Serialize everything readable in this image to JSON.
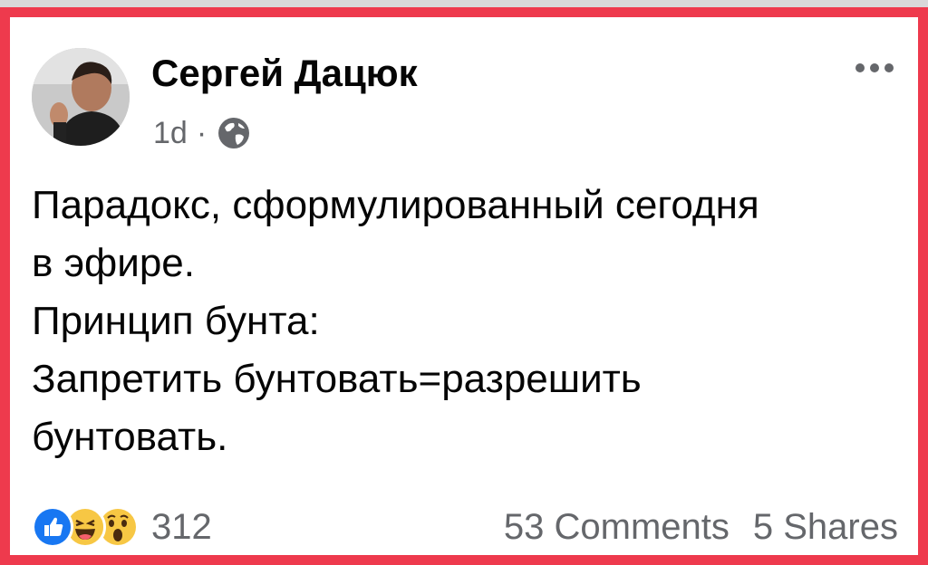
{
  "post": {
    "author": "Сергей Дацюк",
    "time": "1d",
    "separator": "·",
    "audience_icon": "globe-icon",
    "lines": [
      "Парадокс, сформулированный сегодня",
      "в эфире.",
      "Принцип бунта:",
      "Запретить бунтовать=разрешить",
      "бунтовать."
    ]
  },
  "footer": {
    "reaction_icons": [
      "like-icon",
      "haha-icon",
      "wow-icon"
    ],
    "reaction_count": "312",
    "comments": "53 Comments",
    "shares": "5 Shares"
  },
  "colors": {
    "frame": "#ee3a4d",
    "like_blue": "#1877f2",
    "emoji_yellow": "#f7c744",
    "secondary_text": "#65676b",
    "primary_text": "#050505"
  }
}
